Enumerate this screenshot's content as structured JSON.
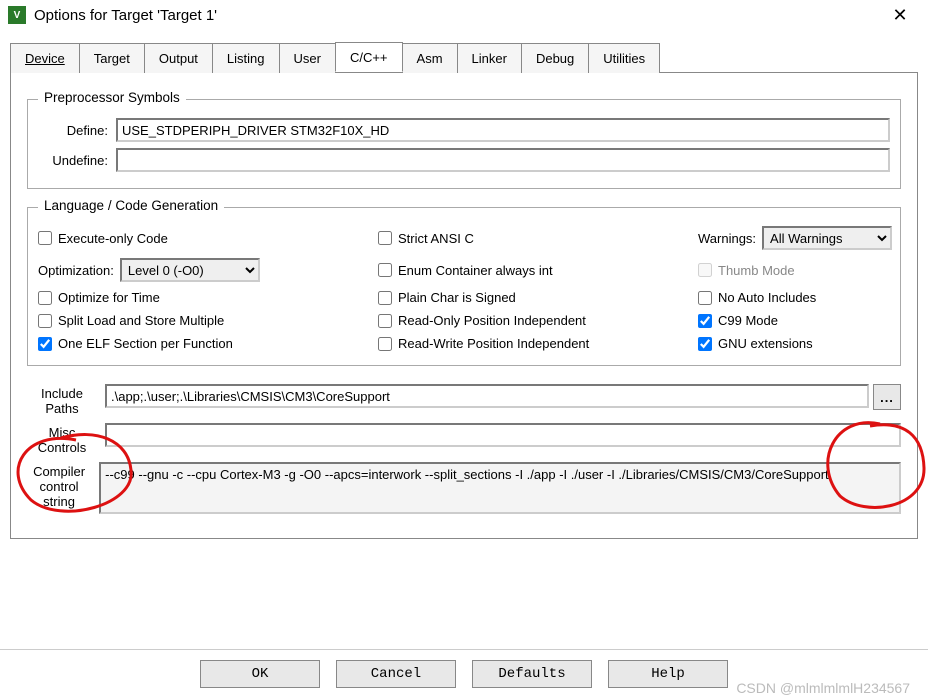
{
  "window": {
    "title": "Options for Target 'Target 1'"
  },
  "tabs": {
    "device": "Device",
    "target": "Target",
    "output": "Output",
    "listing": "Listing",
    "user": "User",
    "ccpp": "C/C++",
    "asm": "Asm",
    "linker": "Linker",
    "debug": "Debug",
    "utilities": "Utilities"
  },
  "group_pp": {
    "title": "Preprocessor Symbols",
    "define_label": "Define:",
    "define_value": "USE_STDPERIPH_DRIVER STM32F10X_HD",
    "undefine_label": "Undefine:",
    "undefine_value": ""
  },
  "group_lang": {
    "title": "Language / Code Generation",
    "exec_only": "Execute-only Code",
    "opt_label": "Optimization:",
    "opt_value": "Level 0 (-O0)",
    "opt_time": "Optimize for Time",
    "split_ls": "Split Load and Store Multiple",
    "one_elf": "One ELF Section per Function",
    "strict_ansi": "Strict ANSI C",
    "enum_cont": "Enum Container always int",
    "plain_char": "Plain Char is Signed",
    "ro_pi": "Read-Only Position Independent",
    "rw_pi": "Read-Write Position Independent",
    "warn_label": "Warnings:",
    "warn_value": "All Warnings",
    "thumb": "Thumb Mode",
    "no_auto": "No Auto Includes",
    "c99": "C99 Mode",
    "gnu": "GNU extensions"
  },
  "lower": {
    "include_label": "Include\nPaths",
    "include_value": ".\\app;.\\user;.\\Libraries\\CMSIS\\CM3\\CoreSupport",
    "browse": "...",
    "misc_label": "Misc\nControls",
    "misc_value": "",
    "ccs_label": "Compiler\ncontrol\nstring",
    "ccs_value": "--c99 --gnu -c --cpu Cortex-M3 -g -O0 --apcs=interwork --split_sections -I ./app -I ./user -I ./Libraries/CMSIS/CM3/CoreSupport"
  },
  "buttons": {
    "ok": "OK",
    "cancel": "Cancel",
    "defaults": "Defaults",
    "help": "Help"
  },
  "watermark": "CSDN @mlmlmlmlH234567"
}
